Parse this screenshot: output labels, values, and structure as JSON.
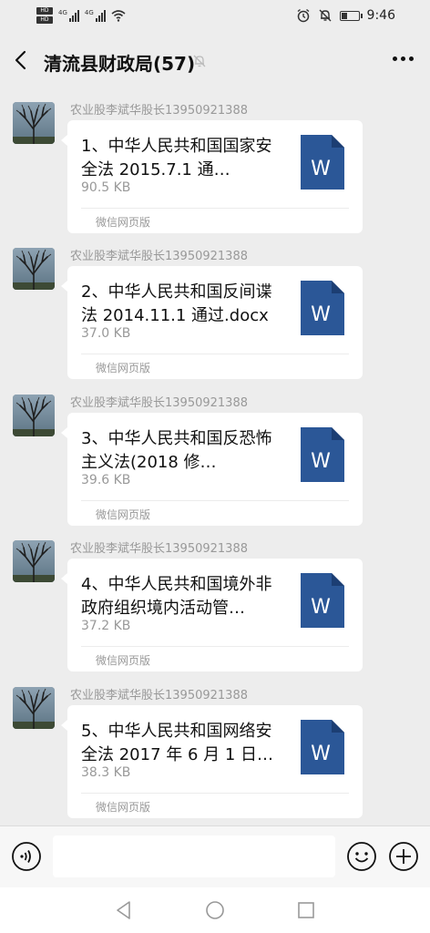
{
  "status_bar": {
    "time": "9:46",
    "hd_labels": [
      "HD",
      "HD"
    ],
    "network_labels": [
      "4G",
      "4G"
    ],
    "battery_level": 0.4
  },
  "header": {
    "title": "清流县财政局(57)",
    "back_icon": "chevron-left-icon",
    "mute_icon": "bell-off-icon",
    "more_icon": "more-dots-icon"
  },
  "messages": [
    {
      "sender": "农业股李斌华股长13950921388",
      "file_name": "1、中华人民共和国国家安全法 2015.7.1 通…",
      "file_size": "90.5 KB",
      "source": "微信网页版",
      "file_icon": "word-doc-icon",
      "file_icon_label": "W"
    },
    {
      "sender": "农业股李斌华股长13950921388",
      "file_name": "2、中华人民共和国反间谍法 2014.11.1 通过.docx",
      "file_size": "37.0 KB",
      "source": "微信网页版",
      "file_icon": "word-doc-icon",
      "file_icon_label": "W"
    },
    {
      "sender": "农业股李斌华股长13950921388",
      "file_name": "3、中华人民共和国反恐怖主义法(2018 修…",
      "file_size": "39.6 KB",
      "source": "微信网页版",
      "file_icon": "word-doc-icon",
      "file_icon_label": "W"
    },
    {
      "sender": "农业股李斌华股长13950921388",
      "file_name": "4、中华人民共和国境外非政府组织境内活动管…",
      "file_size": "37.2 KB",
      "source": "微信网页版",
      "file_icon": "word-doc-icon",
      "file_icon_label": "W"
    },
    {
      "sender": "农业股李斌华股长13950921388",
      "file_name": "5、中华人民共和国网络安全法 2017 年 6 月 1 日…",
      "file_size": "38.3 KB",
      "source": "微信网页版",
      "file_icon": "word-doc-icon",
      "file_icon_label": "W"
    }
  ],
  "input_bar": {
    "voice_icon": "voice-input-icon",
    "emoji_icon": "emoji-icon",
    "plus_icon": "plus-circle-icon",
    "text_value": ""
  },
  "nav_bar": {
    "back_icon": "triangle-back-icon",
    "home_icon": "circle-home-icon",
    "recent_icon": "square-recent-icon"
  },
  "colors": {
    "background": "#ededed",
    "card": "#ffffff",
    "word_blue": "#2b5797",
    "muted_text": "#999999"
  }
}
